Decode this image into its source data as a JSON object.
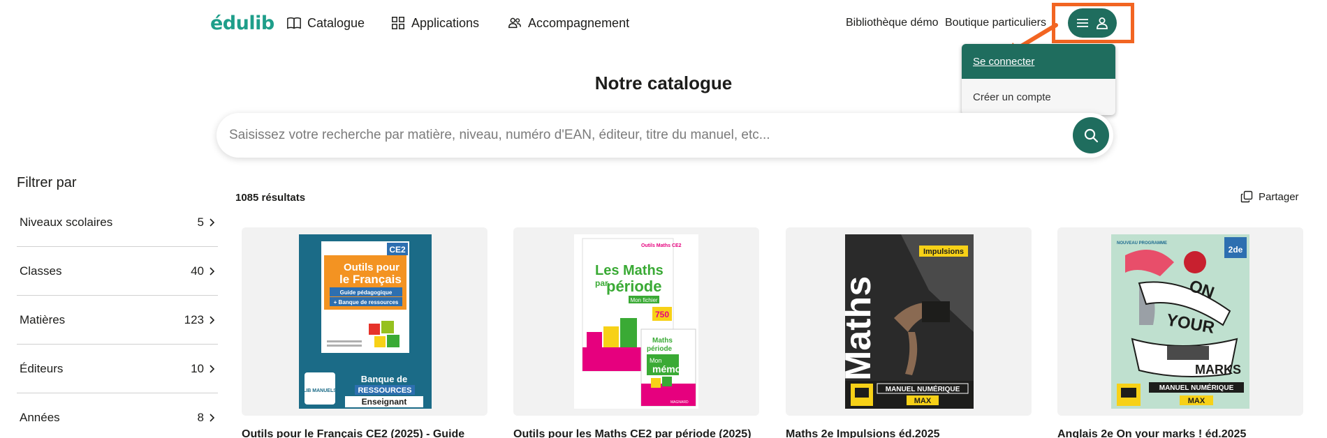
{
  "header": {
    "logo": "édulib",
    "nav": [
      {
        "label": "Catalogue",
        "icon": "book-icon"
      },
      {
        "label": "Applications",
        "icon": "apps-grid-icon"
      },
      {
        "label": "Accompagnement",
        "icon": "users-icon"
      }
    ],
    "links": [
      "Bibliothèque démo",
      "Boutique particuliers"
    ]
  },
  "account_menu": {
    "login": "Se connecter",
    "signup": "Créer un compte"
  },
  "page_title": "Notre catalogue",
  "search": {
    "placeholder": "Saisissez votre recherche par matière, niveau, numéro d'EAN, éditeur, titre du manuel, etc..."
  },
  "filters": {
    "title": "Filtrer par",
    "items": [
      {
        "label": "Niveaux scolaires",
        "count": "5"
      },
      {
        "label": "Classes",
        "count": "40"
      },
      {
        "label": "Matières",
        "count": "123"
      },
      {
        "label": "Éditeurs",
        "count": "10"
      },
      {
        "label": "Années",
        "count": "8"
      }
    ]
  },
  "results": {
    "count": "1085 résultats",
    "share": "Partager"
  },
  "products": [
    {
      "title": "Outils pour le Français CE2 (2025) - Guide",
      "cover": {
        "top": "CE2",
        "line1": "Outils pour",
        "line2": "le Français",
        "sub1": "Guide pédagogique",
        "sub2": "+ Banque de ressources",
        "bottom1": "Banque de",
        "bottom2": "RESSOURCES",
        "bottom3": "Enseignant",
        "badge": "LIB MANUELS"
      }
    },
    {
      "title": "Outils pour les Maths CE2 par période (2025)",
      "cover": {
        "line1": "Les Maths",
        "line2": "par",
        "line3": "période",
        "sub": "Mon fichier",
        "badge": "750",
        "small1": "Maths",
        "small2": "période",
        "memo1": "Mon",
        "memo2": "mémo",
        "top": "Outils Maths CE2",
        "publisher": "MAGNARD"
      }
    },
    {
      "title": "Maths 2e Impulsions éd.2025",
      "cover": {
        "brand": "Impulsions",
        "big": "Maths",
        "label": "MANUEL NUMÉRIQUE",
        "sub": "MAX"
      }
    },
    {
      "title": "Anglais 2e On your marks ! éd.2025",
      "cover": {
        "w1": "ON",
        "w2": "YOUR",
        "w3": "MARKS",
        "label": "MANUEL NUMÉRIQUE",
        "sub": "MAX",
        "top": "NOUVEAU PROGRAMME",
        "level": "2de"
      }
    }
  ],
  "colors": {
    "brand": "#1e9e8a",
    "accent": "#1f6d5e",
    "highlight": "#f26522"
  }
}
